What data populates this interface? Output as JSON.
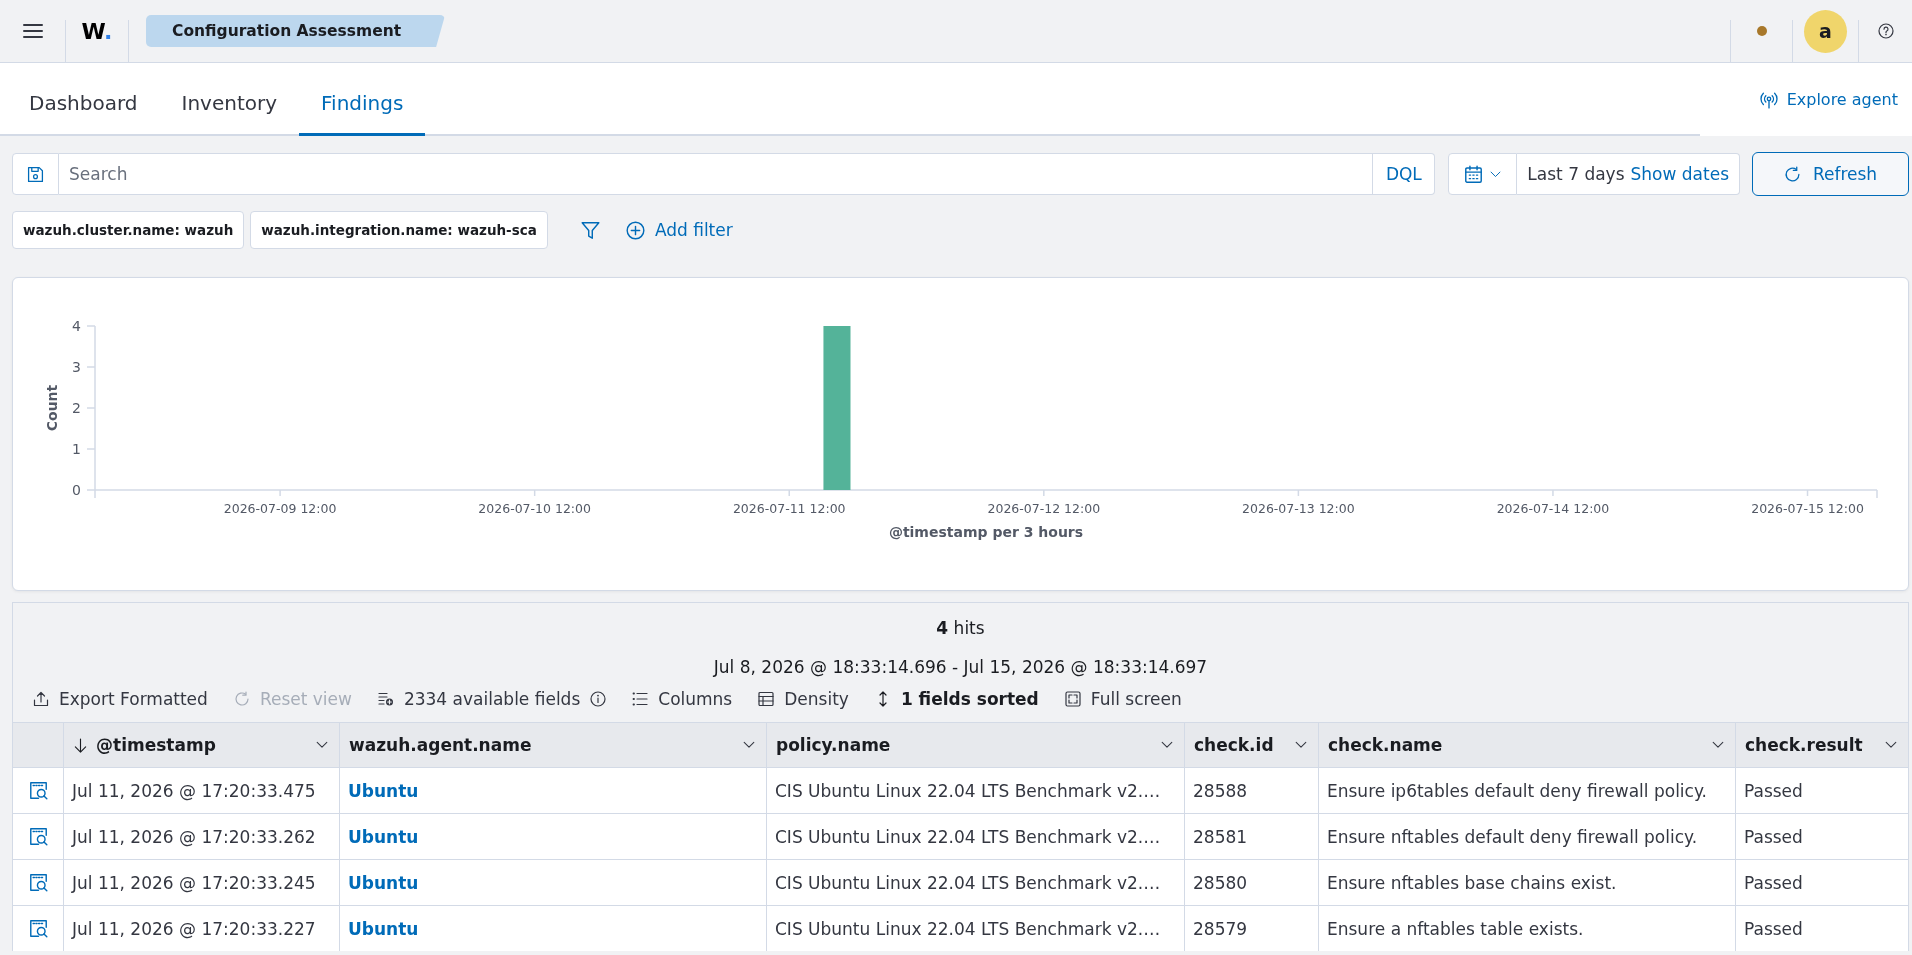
{
  "header": {
    "logo": "W.",
    "breadcrumb": "Configuration Assessment",
    "avatar": "a"
  },
  "tabs": [
    {
      "label": "Dashboard",
      "selected": false
    },
    {
      "label": "Inventory",
      "selected": false
    },
    {
      "label": "Findings",
      "selected": true
    }
  ],
  "explore_agent": "Explore agent",
  "query_bar": {
    "placeholder": "Search",
    "language": "DQL",
    "date_range": "Last 7 days",
    "show_dates": "Show dates",
    "refresh": "Refresh"
  },
  "filters": [
    "wazuh.cluster.name: wazuh",
    "wazuh.integration.name: wazuh-sca"
  ],
  "add_filter": "Add filter",
  "histogram": {
    "chart_data": {
      "type": "bar",
      "xlabel": "@timestamp per 3 hours",
      "ylabel": "Count",
      "x": [
        "2026-07-11 16:30"
      ],
      "values": [
        4
      ],
      "xlim": [
        "2026-07-08 18:33",
        "2026-07-15 18:33"
      ],
      "ylim": [
        0,
        4
      ],
      "xticks": [
        "2026-07-09 12:00",
        "2026-07-10 12:00",
        "2026-07-11 12:00",
        "2026-07-12 12:00",
        "2026-07-13 12:00",
        "2026-07-14 12:00",
        "2026-07-15 12:00"
      ],
      "yticks": [
        0,
        1,
        2,
        3,
        4
      ]
    }
  },
  "results": {
    "hits": "**4** hits",
    "time_range": "Jul 8, 2026 @ 18:33:14.696 - Jul 15, 2026 @ 18:33:14.697",
    "toolbar": [
      {
        "kind": "export",
        "label": "Export Formatted",
        "disabled": false
      },
      {
        "kind": "reset",
        "label": "Reset view",
        "disabled": true
      },
      {
        "kind": "fields",
        "label": "2334 available fields",
        "disabled": false
      },
      {
        "kind": "columns",
        "label": "Columns",
        "disabled": false
      },
      {
        "kind": "density",
        "label": "Density",
        "disabled": false
      },
      {
        "kind": "sort",
        "label": "1 fields sorted",
        "disabled": false
      },
      {
        "kind": "fullscreen",
        "label": "Full screen",
        "disabled": false
      }
    ],
    "table": {
      "columns": [
        {
          "label": "@timestamp",
          "kind": "text",
          "sorted": true
        },
        {
          "label": "wazuh.agent.name",
          "kind": "link",
          "sorted": false
        },
        {
          "label": "policy.name",
          "kind": "text",
          "sorted": false
        },
        {
          "label": "check.id",
          "kind": "text",
          "sorted": false
        },
        {
          "label": "check.name",
          "kind": "text",
          "sorted": false
        },
        {
          "label": "check.result",
          "kind": "text",
          "sorted": false
        }
      ],
      "rows": [
        [
          "Jul 11, 2026 @ 17:20:33.475",
          "Ubuntu",
          "CIS Ubuntu Linux 22.04 LTS Benchmark v2.…",
          "28588",
          "Ensure ip6tables default deny firewall policy.",
          "Passed"
        ],
        [
          "Jul 11, 2026 @ 17:20:33.262",
          "Ubuntu",
          "CIS Ubuntu Linux 22.04 LTS Benchmark v2.…",
          "28581",
          "Ensure nftables default deny firewall policy.",
          "Passed"
        ],
        [
          "Jul 11, 2026 @ 17:20:33.245",
          "Ubuntu",
          "CIS Ubuntu Linux 22.04 LTS Benchmark v2.…",
          "28580",
          "Ensure nftables base chains exist.",
          "Passed"
        ],
        [
          "Jul 11, 2026 @ 17:20:33.227",
          "Ubuntu",
          "CIS Ubuntu Linux 22.04 LTS Benchmark v2.…",
          "28579",
          "Ensure a nftables table exists.",
          "Passed"
        ]
      ]
    }
  }
}
